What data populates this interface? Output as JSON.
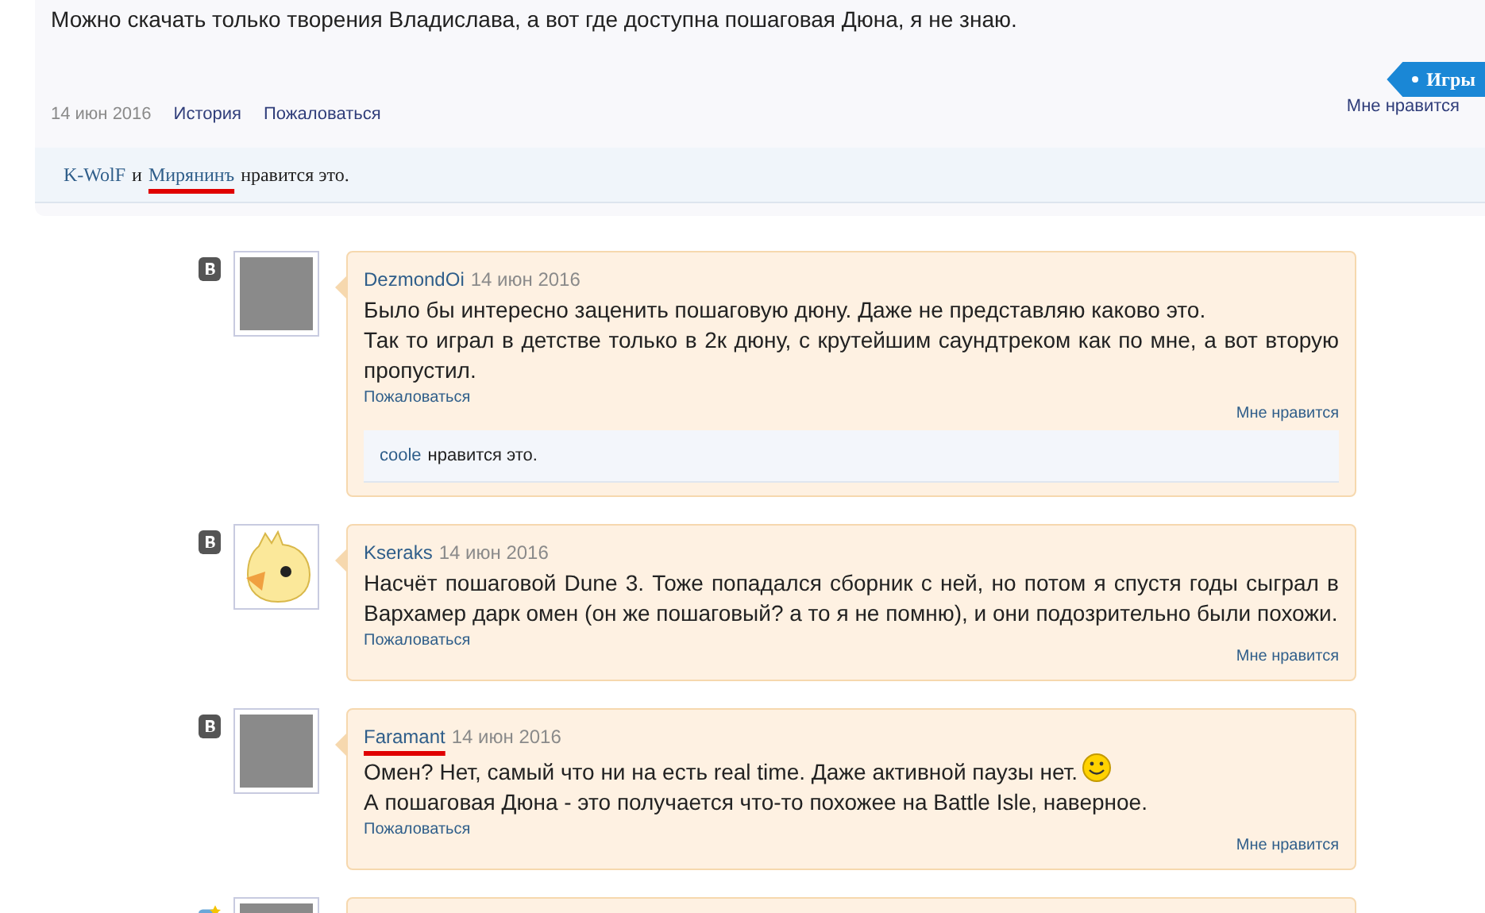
{
  "post": {
    "text": "Можно скачать только творения Владислава, а вот где доступна пошаговая Дюна, я не знаю.",
    "tag": "Игры",
    "date": "14 июн 2016",
    "links": [
      "История",
      "Пожаловаться"
    ],
    "like_button": "Мне нравится",
    "likes": {
      "names": [
        {
          "name": "K-WolF",
          "underlined": false
        },
        {
          "name": "Мирянинъ",
          "underlined": true
        }
      ],
      "joiner": "и",
      "suffix": "нравится это."
    }
  },
  "comments": [
    {
      "badge": {
        "kind": "plain"
      },
      "avatar": {
        "kind": "photo"
      },
      "author": "DezmondOi",
      "author_underlined": false,
      "date": "14 июн 2016",
      "paragraphs": [
        {
          "text": "Было бы интересно заценить пошаговую дюну. Даже не представляю каково это.",
          "smiley": false
        },
        {
          "text": "Так то играл в детстве только в 2к дюну, с крутейшим саундтреком как по мне, а вот вторую пропустил.",
          "smiley": false
        }
      ],
      "report": "Пожаловаться",
      "like": "Мне нравится",
      "likes": {
        "names": [
          "coole"
        ],
        "suffix": "нравится это."
      }
    },
    {
      "badge": {
        "kind": "plain"
      },
      "avatar": {
        "kind": "chick"
      },
      "author": "Kseraks",
      "author_underlined": false,
      "date": "14 июн 2016",
      "paragraphs": [
        {
          "text": "Насчёт пошаговой Dune 3. Тоже попадался сборник с ней, но потом я спустя годы сыграл в Вархамер дарк омен (он же пошаговый? а то я не помню), и они подозрительно были похожи.",
          "smiley": false
        }
      ],
      "report": "Пожаловаться",
      "like": "Мне нравится"
    },
    {
      "badge": {
        "kind": "plain"
      },
      "avatar": {
        "kind": "photo"
      },
      "author": "Faramant",
      "author_underlined": true,
      "date": "14 июн 2016",
      "paragraphs": [
        {
          "text": "Омен? Нет, самый что ни на есть real time. Даже активной паузы нет.",
          "smiley": true
        },
        {
          "text": "А пошаговая Дюна - это получается что-то похожее на Battle Isle, наверное.",
          "smiley": false
        }
      ],
      "report": "Пожаловаться",
      "like": "Мне нравится"
    },
    {
      "badge": {
        "kind": "star"
      },
      "avatar": {
        "kind": "photo"
      }
    }
  ]
}
